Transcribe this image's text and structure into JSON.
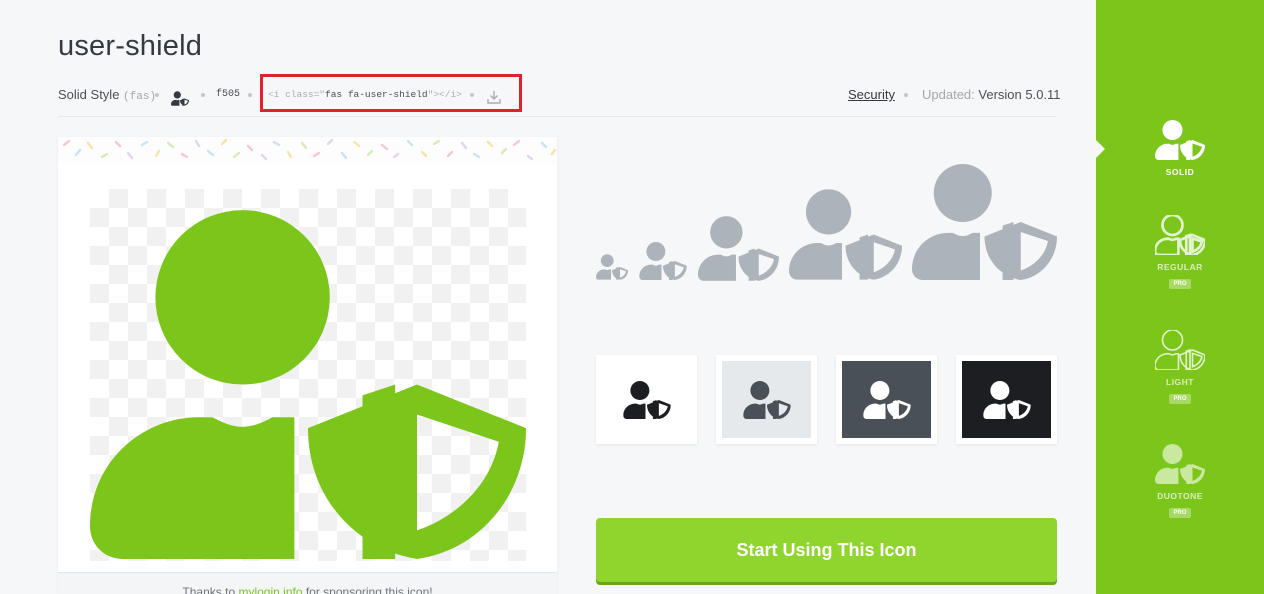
{
  "page": {
    "title": "user-shield"
  },
  "meta": {
    "style_label": "Solid Style",
    "style_prefix": "(fas)",
    "unicode": "f505",
    "snippet_open": "<i class=\"",
    "snippet_class": "fas fa-user-shield",
    "snippet_close": "\"></i>",
    "category": "Security",
    "updated_label": "Updated:",
    "version": "Version 5.0.11"
  },
  "preview": {
    "sponsor_prefix": "Thanks to",
    "sponsor_link": "mylogin.info",
    "sponsor_suffix": "for sponsoring this icon!"
  },
  "cta": {
    "label": "Start Using This Icon"
  },
  "sidebar": {
    "items": [
      {
        "label": "SOLID",
        "pro": ""
      },
      {
        "label": "REGULAR",
        "pro": "PRO"
      },
      {
        "label": "LIGHT",
        "pro": "PRO"
      },
      {
        "label": "DUOTONE",
        "pro": "PRO"
      }
    ]
  },
  "colors": {
    "brand_green": "#7cc61c",
    "cta_green": "#8fd52d",
    "icon_gray": "#acb3ba",
    "highlight_red": "#e0212e"
  },
  "icons": {
    "main": "user-shield-icon",
    "download": "download-icon"
  }
}
